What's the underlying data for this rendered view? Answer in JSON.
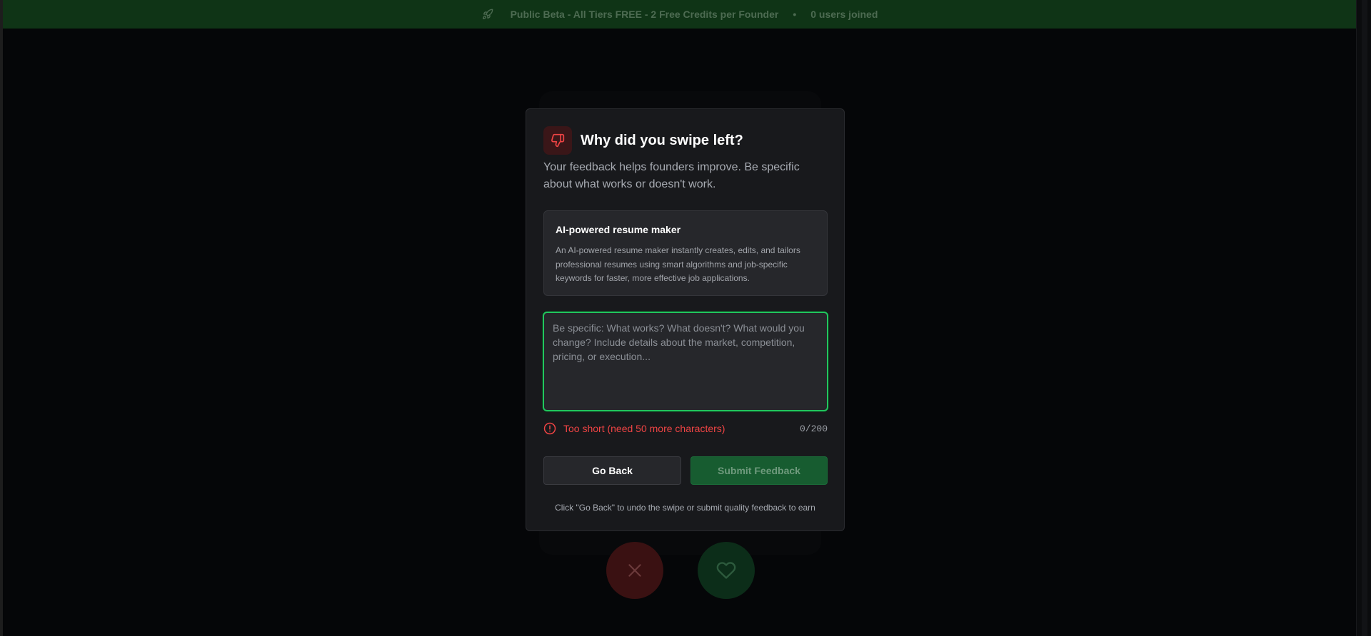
{
  "banner": {
    "text": "Public Beta - All Tiers FREE - 2 Free Credits per Founder",
    "separator": "•",
    "users_joined": "0 users joined",
    "icon": "rocket-icon"
  },
  "modal": {
    "icon": "thumbs-down-icon",
    "title": "Why did you swipe left?",
    "description": "Your feedback helps founders improve. Be specific about what works or doesn't work.",
    "idea": {
      "title": "AI-powered resume maker",
      "description": "An AI-powered resume maker instantly creates, edits, and tailors professional resumes using smart algorithms and job-specific keywords for faster, more effective job applications."
    },
    "feedback": {
      "value": "",
      "placeholder": "Be specific: What works? What doesn't? What would you change? Include details about the market, competition, pricing, or execution..."
    },
    "validation": {
      "icon": "alert-circle-icon",
      "message": "Too short (need 50 more characters)",
      "char_count": "0/200"
    },
    "buttons": {
      "back": "Go Back",
      "submit": "Submit Feedback"
    },
    "footnote": "Click \"Go Back\" to undo the swipe or submit quality feedback to earn"
  },
  "background_actions": {
    "pass_icon": "close-icon",
    "like_icon": "heart-icon"
  },
  "colors": {
    "accent_green": "#22c55e",
    "error_red": "#ef4444",
    "banner_bg": "#0f3416",
    "modal_bg": "#18191c"
  }
}
